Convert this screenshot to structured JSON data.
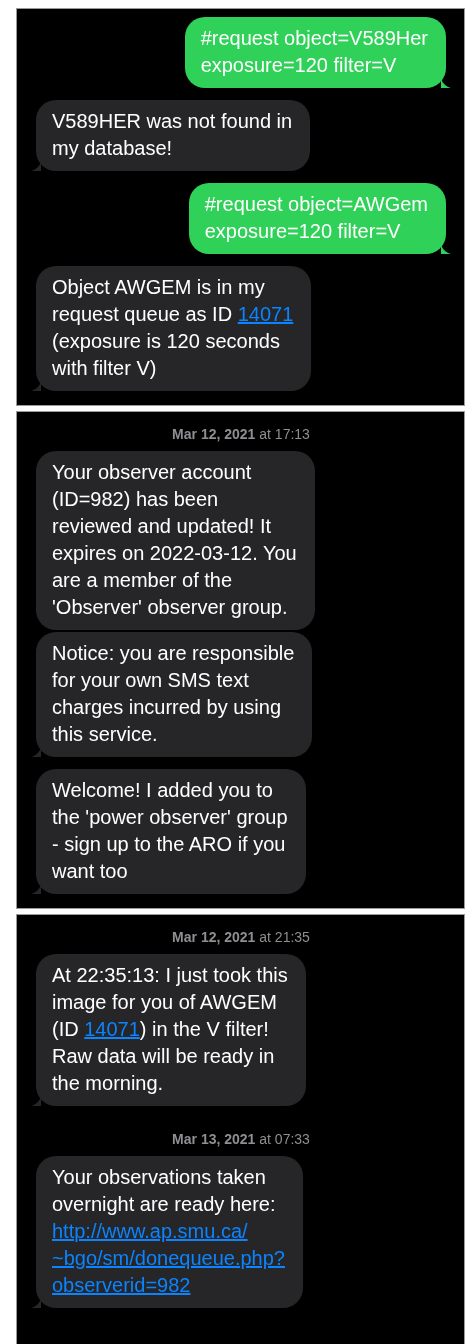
{
  "panels": [
    {
      "items": [
        {
          "kind": "sent",
          "tail": true,
          "parts": [
            {
              "kind": "text",
              "text": "#request object=V589Her\nexposure=120 filter=V"
            }
          ]
        },
        {
          "kind": "received",
          "tail": true,
          "parts": [
            {
              "kind": "text",
              "text": "V589HER was not found in\nmy database!"
            }
          ]
        },
        {
          "kind": "sent",
          "tail": true,
          "parts": [
            {
              "kind": "text",
              "text": "#request object=AWGem\nexposure=120 filter=V"
            }
          ]
        },
        {
          "kind": "received",
          "tail": true,
          "parts": [
            {
              "kind": "text",
              "text": "Object AWGEM is in my\nrequest queue as ID "
            },
            {
              "kind": "link",
              "text": "14071"
            },
            {
              "kind": "text",
              "text": "\n(exposure is 120 seconds\nwith filter V)"
            }
          ]
        }
      ]
    },
    {
      "items": [
        {
          "kind": "timestamp",
          "text": "**Mar 12, 2021** at 17:13"
        },
        {
          "kind": "received",
          "tail": false,
          "parts": [
            {
              "kind": "text",
              "text": "Your observer account\n(ID=982) has been\nreviewed and updated! It\nexpires on 2022-03-12. You\nare a member of the\n'Observer' observer group."
            }
          ]
        },
        {
          "kind": "received",
          "tail": true,
          "parts": [
            {
              "kind": "text",
              "text": "Notice: you are responsible\nfor your own SMS text\ncharges incurred by using\nthis service."
            }
          ]
        },
        {
          "kind": "received",
          "tail": true,
          "parts": [
            {
              "kind": "text",
              "text": "Welcome! I added you to\nthe 'power observer' group\n- sign up to the ARO if you\nwant too"
            }
          ]
        }
      ]
    },
    {
      "items": [
        {
          "kind": "timestamp",
          "text": "**Mar 12, 2021** at 21:35"
        },
        {
          "kind": "received",
          "tail": true,
          "parts": [
            {
              "kind": "text",
              "text": "At 22:35:13: I just took this\nimage for you of AWGEM\n(ID "
            },
            {
              "kind": "link",
              "text": "14071"
            },
            {
              "kind": "text",
              "text": ") in the V filter!\nRaw data will be ready in\nthe morning."
            }
          ]
        },
        {
          "kind": "timestamp",
          "text": "**Mar 13, 2021** at 07:33"
        },
        {
          "kind": "received",
          "tail": true,
          "parts": [
            {
              "kind": "text",
              "text": "Your observations taken\novernight are ready here:\n"
            },
            {
              "kind": "link",
              "text": "http://www.ap.smu.ca/"
            },
            {
              "kind": "link",
              "text": "~bgo/sm/donequeue.php?"
            },
            {
              "kind": "link",
              "text": "observerid=982"
            }
          ]
        }
      ]
    }
  ]
}
